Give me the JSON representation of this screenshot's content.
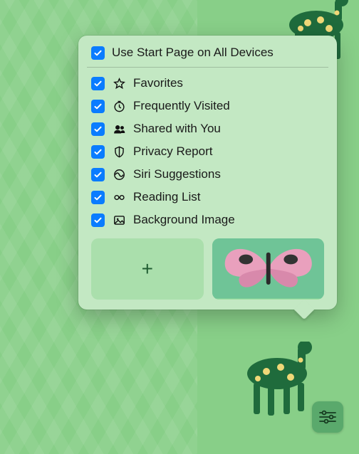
{
  "popover": {
    "header": {
      "label": "Use Start Page on All Devices",
      "checked": true
    },
    "options": [
      {
        "icon": "star",
        "label": "Favorites",
        "checked": true
      },
      {
        "icon": "clock",
        "label": "Frequently Visited",
        "checked": true
      },
      {
        "icon": "people",
        "label": "Shared with You",
        "checked": true
      },
      {
        "icon": "shield",
        "label": "Privacy Report",
        "checked": true
      },
      {
        "icon": "siri",
        "label": "Siri Suggestions",
        "checked": true
      },
      {
        "icon": "glasses",
        "label": "Reading List",
        "checked": true
      },
      {
        "icon": "image",
        "label": "Background Image",
        "checked": true
      }
    ],
    "thumbs": {
      "add_label": "+",
      "wallpaper_name": "Butterfly"
    }
  },
  "colors": {
    "accent": "#0a7cff",
    "panel": "#c3e8c3",
    "bg": "#88cf88"
  }
}
